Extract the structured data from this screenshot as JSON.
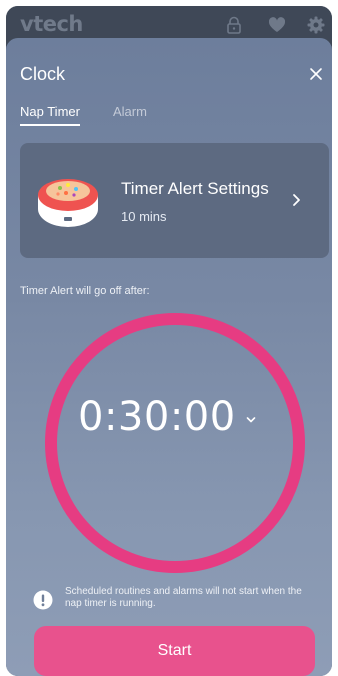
{
  "app": {
    "brand": "vtech"
  },
  "header_icons": [
    "lock-icon",
    "heart-icon",
    "gear-icon"
  ],
  "sheet": {
    "title": "Clock"
  },
  "tabs": [
    {
      "label": "Nap Timer",
      "selected": true
    },
    {
      "label": "Alarm",
      "selected": false
    }
  ],
  "settings_card": {
    "title": "Timer Alert Settings",
    "subtitle": "10 mins"
  },
  "timer": {
    "label": "Timer Alert will go off after:",
    "time": "0:30:00"
  },
  "notice": {
    "text": "Scheduled routines and alarms will not start when the nap timer is running."
  },
  "actions": {
    "start_label": "Start"
  },
  "colors": {
    "accent": "#e8528d",
    "ring": "#e63c82",
    "card": "#5d6a81",
    "topbar": "#3f4857"
  }
}
